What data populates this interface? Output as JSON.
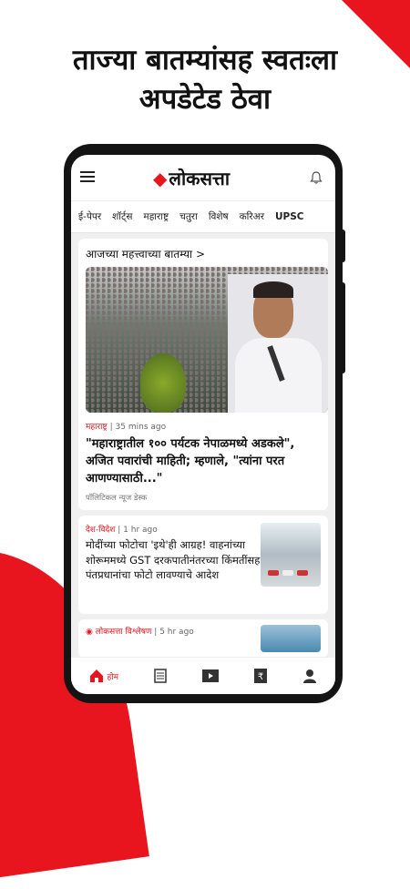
{
  "promo": {
    "headline_line1": "ताज्या बातम्यांसह स्वतःला",
    "headline_line2": "अपडेटेड ठेवा"
  },
  "app": {
    "logo_text": "लोकसत्ता",
    "tabs": [
      "ई-पेपर",
      "शॉर्ट्स",
      "महाराष्ट्र",
      "चतुरा",
      "विशेष",
      "करिअर",
      "UPSC"
    ]
  },
  "feed": {
    "section_title": "आजच्या महत्त्वाच्या बातम्या >",
    "top_story": {
      "category": "महाराष्ट्र",
      "time": "35 mins ago",
      "headline": "\"महाराष्ट्रातील १०० पर्यटक नेपाळमध्ये अडकले\", अजित पवारांची माहिती; म्हणाले, \"त्यांना परत आणण्यासाठी...\"",
      "author": "पॉलिटिकल न्यूज डेस्क"
    },
    "story2": {
      "category": "देश-विदेश",
      "time": "1 hr ago",
      "headline": "मोदींच्या फोटोचा 'इथे'ही आग्रह! वाहनांच्या शोरूममध्ये GST दरकपातीनंतरच्या किंमतींसह पंतप्रधानांचा फोटो लावण्याचे आदेश"
    },
    "story3": {
      "category": "लोकसत्ता विश्लेषण",
      "time": "5 hr ago"
    }
  },
  "bottom_nav": {
    "home_label": "होम"
  },
  "colors": {
    "brand_red": "#e8141e"
  }
}
